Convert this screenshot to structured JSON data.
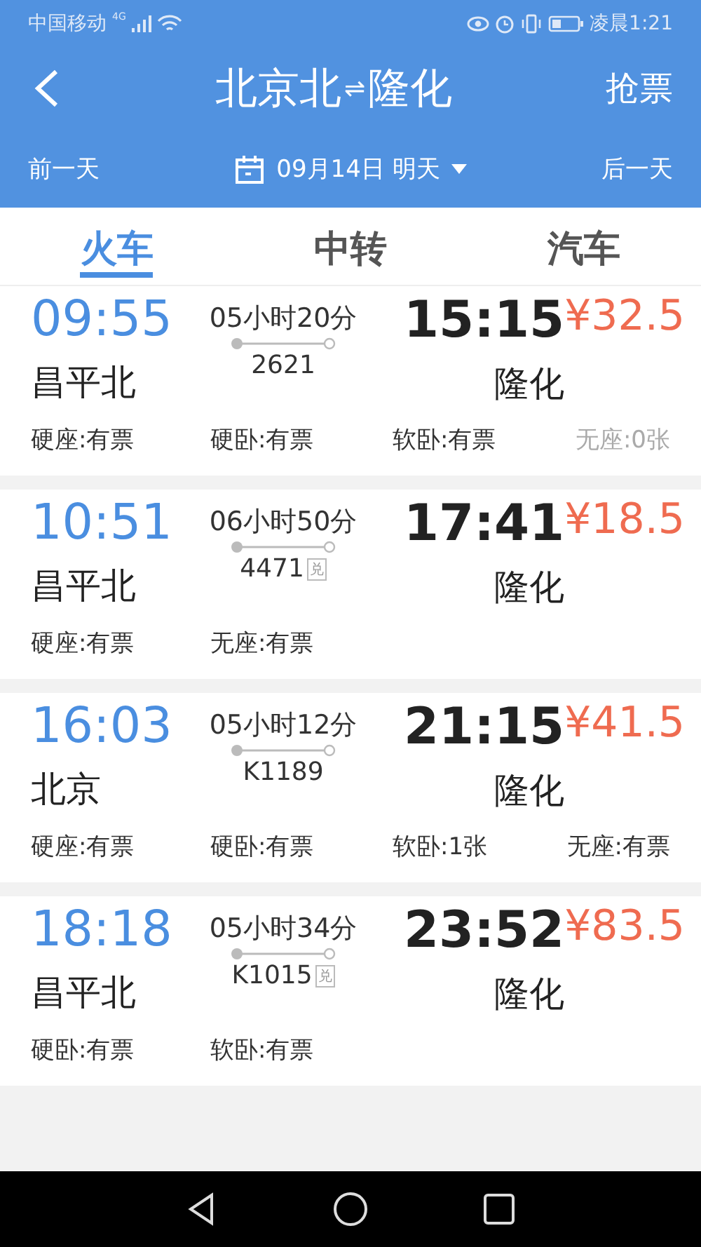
{
  "status_bar": {
    "carrier": "中国移动",
    "network": "4G",
    "time": "凌晨1:21"
  },
  "header": {
    "title_from": "北京北",
    "title_swap": "⇌",
    "title_to": "隆化",
    "action": "抢票"
  },
  "date_bar": {
    "prev": "前一天",
    "date": "09月14日 明天",
    "next": "后一天"
  },
  "tabs": [
    {
      "label": "火车",
      "selected": true
    },
    {
      "label": "中转",
      "selected": false
    },
    {
      "label": "汽车",
      "selected": false
    }
  ],
  "trains": [
    {
      "depart_time": "09:55",
      "depart_station": "昌平北",
      "duration": "05小时20分",
      "train_no": "2621",
      "arrive_time": "15:15",
      "arrive_station": "隆化",
      "price": "¥32.5",
      "seats": [
        {
          "text": "硬座:有票",
          "available": true
        },
        {
          "text": "硬卧:有票",
          "available": true
        },
        {
          "text": "软卧:有票",
          "available": true
        },
        {
          "text": "无座:0张",
          "available": false
        }
      ]
    },
    {
      "depart_time": "10:51",
      "depart_station": "昌平北",
      "duration": "06小时50分",
      "train_no": "4471",
      "badge": "兑",
      "arrive_time": "17:41",
      "arrive_station": "隆化",
      "price": "¥18.5",
      "seats": [
        {
          "text": "硬座:有票",
          "available": true
        },
        {
          "text": "无座:有票",
          "available": true
        }
      ]
    },
    {
      "depart_time": "16:03",
      "depart_station": "北京",
      "duration": "05小时12分",
      "train_no": "K1189",
      "arrive_time": "21:15",
      "arrive_station": "隆化",
      "price": "¥41.5",
      "seats": [
        {
          "text": "硬座:有票",
          "available": true
        },
        {
          "text": "硬卧:有票",
          "available": true
        },
        {
          "text": "软卧:1张",
          "available": true
        },
        {
          "text": "无座:有票",
          "available": true
        }
      ]
    },
    {
      "depart_time": "18:18",
      "depart_station": "昌平北",
      "duration": "05小时34分",
      "train_no": "K1015",
      "badge": "兑",
      "arrive_time": "23:52",
      "arrive_station": "隆化",
      "price": "¥83.5",
      "seats": [
        {
          "text": "硬卧:有票",
          "available": true
        },
        {
          "text": "软卧:有票",
          "available": true
        }
      ]
    }
  ]
}
